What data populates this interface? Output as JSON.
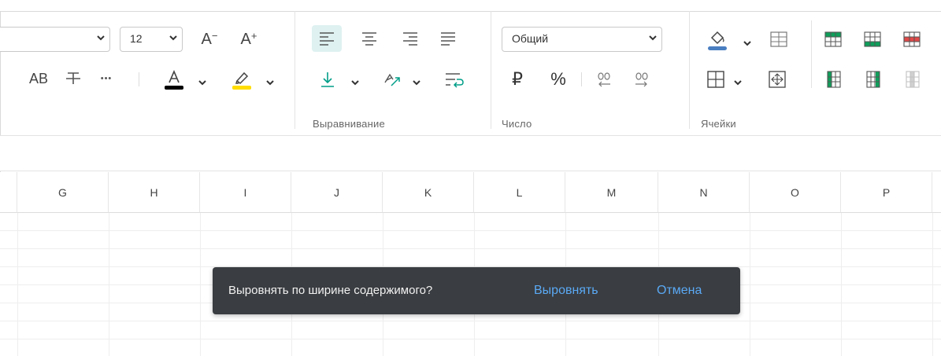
{
  "ribbon": {
    "font_size_value": "12",
    "font_decrease_label": "A",
    "font_increase_label": "A",
    "uppercase_label": "AB",
    "more_label": "•••",
    "number_format_value": "Общий",
    "currency_symbol": "₽",
    "percent_symbol": "%",
    "groups": {
      "alignment": "Выравнивание",
      "number": "Число",
      "cells": "Ячейки"
    },
    "colors": {
      "font_color_bar": "#000000",
      "highlight_bar": "#ffdd00",
      "fill_bar": "#4a7fc1",
      "accent": "#009e88"
    }
  },
  "grid": {
    "columns": [
      "G",
      "H",
      "I",
      "J",
      "K",
      "L",
      "M",
      "N",
      "O",
      "P"
    ]
  },
  "toast": {
    "message": "Выровнять по ширине содержимого?",
    "confirm_label": "Выровнять",
    "cancel_label": "Отмена"
  }
}
